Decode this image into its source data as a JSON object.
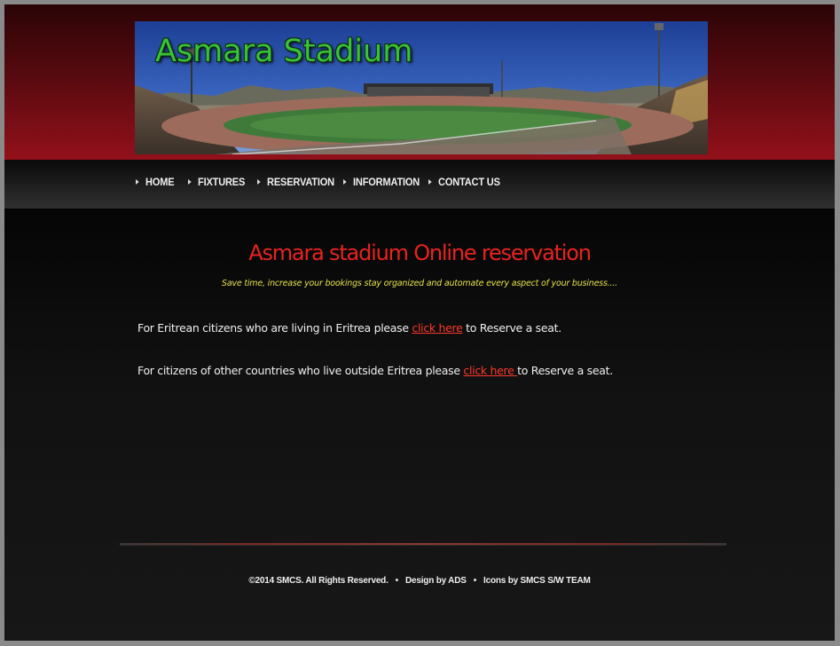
{
  "banner": {
    "title": "Asmara Stadium"
  },
  "nav": {
    "items": [
      {
        "label": "HOME"
      },
      {
        "label": "FIXTURES"
      },
      {
        "label": "RESERVATION"
      },
      {
        "label": "INFORMATION"
      },
      {
        "label": "CONTACT US"
      }
    ]
  },
  "main": {
    "title": "Asmara stadium Online reservation",
    "tagline": "Save time, increase your bookings stay organized and automate every aspect of your business....",
    "paragraphs": [
      {
        "before": "For Eritrean citizens who are living in Eritrea please ",
        "link": "click here",
        "after": " to Reserve a seat."
      },
      {
        "before": "For citizens of other countries who live outside Eritrea please ",
        "link": "click here ",
        "after": "to Reserve a seat."
      }
    ]
  },
  "footer": {
    "copyright": "©2014 SMCS. All Rights Reserved.",
    "separator": "•",
    "design": "Design by ADS",
    "icons": "Icons by SMCS S/W TEAM"
  },
  "colors": {
    "header_red": "#93101a",
    "title_red": "#e8231f",
    "tagline_yellow": "#e6e04a",
    "link_red": "#ff3a2a",
    "banner_title_green": "#39c239"
  }
}
